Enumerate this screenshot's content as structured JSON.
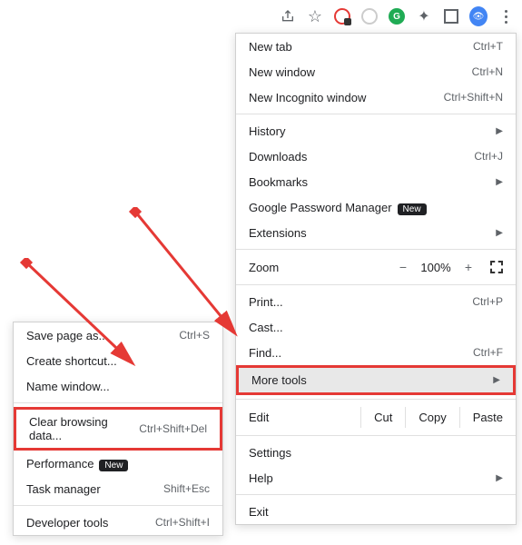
{
  "toolbar": {
    "share_icon": "share-icon",
    "star_icon": "star-icon",
    "ext1_icon": "red-circle-icon",
    "ext2_icon": "gray-circle-icon",
    "ext3_icon": "grammarly-icon",
    "puzzle_icon": "extensions-icon",
    "square_icon": "reading-list-icon",
    "avatar_icon": "profile-avatar",
    "menu_icon": "kebab-menu-icon"
  },
  "main_menu": {
    "new_tab": {
      "label": "New tab",
      "shortcut": "Ctrl+T"
    },
    "new_window": {
      "label": "New window",
      "shortcut": "Ctrl+N"
    },
    "new_incognito": {
      "label": "New Incognito window",
      "shortcut": "Ctrl+Shift+N"
    },
    "history": {
      "label": "History"
    },
    "downloads": {
      "label": "Downloads",
      "shortcut": "Ctrl+J"
    },
    "bookmarks": {
      "label": "Bookmarks"
    },
    "password_mgr": {
      "label": "Google Password Manager",
      "badge": "New"
    },
    "extensions": {
      "label": "Extensions"
    },
    "zoom": {
      "label": "Zoom",
      "minus": "−",
      "value": "100%",
      "plus": "+"
    },
    "print": {
      "label": "Print...",
      "shortcut": "Ctrl+P"
    },
    "cast": {
      "label": "Cast..."
    },
    "find": {
      "label": "Find...",
      "shortcut": "Ctrl+F"
    },
    "more_tools": {
      "label": "More tools"
    },
    "edit": {
      "label": "Edit",
      "cut": "Cut",
      "copy": "Copy",
      "paste": "Paste"
    },
    "settings": {
      "label": "Settings"
    },
    "help": {
      "label": "Help"
    },
    "exit": {
      "label": "Exit"
    }
  },
  "sub_menu": {
    "save_page": {
      "label": "Save page as...",
      "shortcut": "Ctrl+S"
    },
    "create_shortcut": {
      "label": "Create shortcut..."
    },
    "name_window": {
      "label": "Name window..."
    },
    "clear_browsing": {
      "label": "Clear browsing data...",
      "shortcut": "Ctrl+Shift+Del"
    },
    "performance": {
      "label": "Performance",
      "badge": "New"
    },
    "task_manager": {
      "label": "Task manager",
      "shortcut": "Shift+Esc"
    },
    "developer_tools": {
      "label": "Developer tools",
      "shortcut": "Ctrl+Shift+I"
    }
  },
  "annotation": {
    "arrow_color": "#e53935"
  }
}
